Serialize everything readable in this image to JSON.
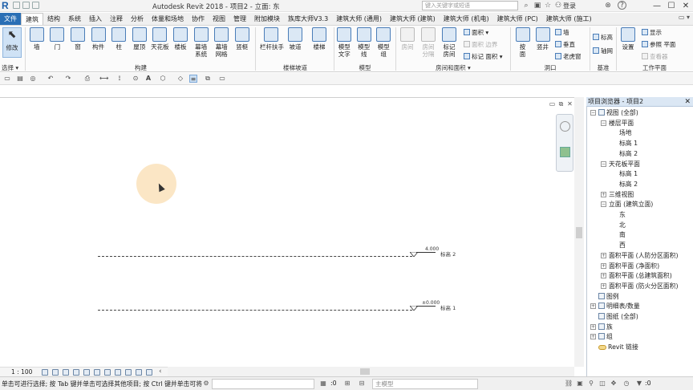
{
  "titlebar": {
    "app_title": "Autodesk Revit 2018 -   项目2 - 立面: 东",
    "search_placeholder": "键入关键字或短语",
    "login_label": "登录",
    "help_label": "?",
    "min_glyph": "—",
    "max_glyph": "☐",
    "close_glyph": "✕"
  },
  "tabs": [
    {
      "label": "文件",
      "state": "file"
    },
    {
      "label": "建筑",
      "state": "active"
    },
    {
      "label": "结构"
    },
    {
      "label": "系统"
    },
    {
      "label": "插入"
    },
    {
      "label": "注释"
    },
    {
      "label": "分析"
    },
    {
      "label": "体量和场地"
    },
    {
      "label": "协作"
    },
    {
      "label": "视图"
    },
    {
      "label": "管理"
    },
    {
      "label": "附加模块"
    },
    {
      "label": "族库大师V3.3"
    },
    {
      "label": "建筑大师 (通用)"
    },
    {
      "label": "建筑大师 (建筑)"
    },
    {
      "label": "建筑大师 (机电)"
    },
    {
      "label": "建筑大师 (PC)"
    },
    {
      "label": "建筑大师 (施工)"
    }
  ],
  "ribbon": {
    "modify": "修改",
    "select_label": "选择 ▾",
    "build_buttons": [
      "墙",
      "门",
      "窗",
      "构件",
      "柱",
      "屋顶",
      "天花板",
      "楼板",
      "幕墙\n系统",
      "幕墙\n网格",
      "竖梃"
    ],
    "build_panel": "构建",
    "stairs_buttons": [
      "栏杆扶手",
      "坡道",
      "楼梯"
    ],
    "stairs_panel": "楼梯坡道",
    "model_buttons": [
      "模型\n文字",
      "模型\n线",
      "模型\n组"
    ],
    "model_panel": "模型",
    "room_buttons": [
      "房间",
      "房间\n分隔",
      "标记\n房间"
    ],
    "room_small": [
      "面积 ▾",
      "面积 边界",
      "标记 面积 ▾"
    ],
    "room_panel": "房间和面积 ▾",
    "opening_buttons": [
      "按\n面",
      "竖井"
    ],
    "opening_small": [
      "墙",
      "垂直",
      "老虎窗"
    ],
    "opening_panel": "洞口",
    "datum_small": [
      "标高",
      "轴网"
    ],
    "datum_panel": "基准",
    "workplane_button": "设置",
    "workplane_small": [
      "显示",
      "参照 平面",
      "查看器"
    ],
    "workplane_panel": "工作平面"
  },
  "view": {
    "levels": [
      {
        "name": "标高 2",
        "elevation": "4.000"
      },
      {
        "name": "标高 1",
        "elevation": "±0.000"
      }
    ],
    "scale": "1 : 100"
  },
  "browser": {
    "title": "项目浏览器 - 项目2",
    "items": [
      {
        "label": "视图 (全部)",
        "level": 0,
        "exp": "−",
        "icon": true
      },
      {
        "label": "楼层平面",
        "level": 1,
        "exp": "−"
      },
      {
        "label": "场地",
        "level": 2
      },
      {
        "label": "标高 1",
        "level": 2
      },
      {
        "label": "标高 2",
        "level": 2
      },
      {
        "label": "天花板平面",
        "level": 1,
        "exp": "−"
      },
      {
        "label": "标高 1",
        "level": 2
      },
      {
        "label": "标高 2",
        "level": 2
      },
      {
        "label": "三维视图",
        "level": 1,
        "exp": "+"
      },
      {
        "label": "立面 (建筑立面)",
        "level": 1,
        "exp": "−"
      },
      {
        "label": "东",
        "level": 2
      },
      {
        "label": "北",
        "level": 2
      },
      {
        "label": "南",
        "level": 2
      },
      {
        "label": "西",
        "level": 2
      },
      {
        "label": "面积平面 (人防分区面积)",
        "level": 1,
        "exp": "+"
      },
      {
        "label": "面积平面 (净面积)",
        "level": 1,
        "exp": "+"
      },
      {
        "label": "面积平面 (总建筑面积)",
        "level": 1,
        "exp": "+"
      },
      {
        "label": "面积平面 (防火分区面积)",
        "level": 1,
        "exp": "+"
      },
      {
        "label": "图例",
        "level": 0,
        "icon": true
      },
      {
        "label": "明细表/数量",
        "level": 0,
        "exp": "+",
        "icon": true
      },
      {
        "label": "图纸 (全部)",
        "level": 0,
        "icon": true
      },
      {
        "label": "族",
        "level": 0,
        "exp": "+",
        "icon": true
      },
      {
        "label": "组",
        "level": 0,
        "exp": "+",
        "icon": true
      },
      {
        "label": "Revit 链接",
        "level": 0,
        "icon": "link"
      }
    ]
  },
  "status": {
    "message": "单击可进行选择; 按 Tab 键并单击可选择其他项目; 按 Ctrl 键并单击可将",
    "count_left": ":0",
    "model_field": "主模型",
    "count_right": ":0"
  }
}
